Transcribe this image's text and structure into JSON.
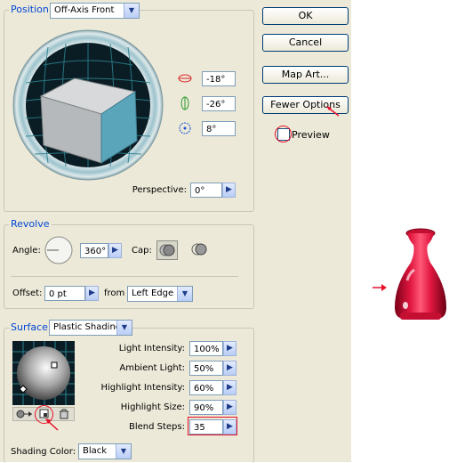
{
  "position": {
    "label": "Position:",
    "preset": "Off-Axis Front",
    "x_rotation": "-18°",
    "y_rotation": "-26°",
    "z_rotation": "8°",
    "perspective_label": "Perspective:",
    "perspective_value": "0°"
  },
  "buttons": {
    "ok": "OK",
    "cancel": "Cancel",
    "map_art": "Map Art...",
    "fewer_options": "Fewer Options",
    "preview_label": "Preview"
  },
  "revolve": {
    "label": "Revolve",
    "angle_label": "Angle:",
    "angle_value": "360°",
    "cap_label": "Cap:",
    "offset_label": "Offset:",
    "offset_value": "0 pt",
    "from_label": "from",
    "from_value": "Left Edge"
  },
  "surface": {
    "label": "Surface:",
    "type": "Plastic Shading",
    "light_intensity_label": "Light Intensity:",
    "light_intensity_value": "100%",
    "ambient_light_label": "Ambient Light:",
    "ambient_light_value": "50%",
    "highlight_intensity_label": "Highlight Intensity:",
    "highlight_intensity_value": "60%",
    "highlight_size_label": "Highlight Size:",
    "highlight_size_value": "90%",
    "blend_steps_label": "Blend Steps:",
    "blend_steps_value": "35",
    "shading_color_label": "Shading Color:",
    "shading_color_value": "Black"
  },
  "colors": {
    "accent": "#0046d5",
    "annotation_red": "#e8102a",
    "vase": "#e0163f",
    "cube_front": "#5aa5ba"
  }
}
